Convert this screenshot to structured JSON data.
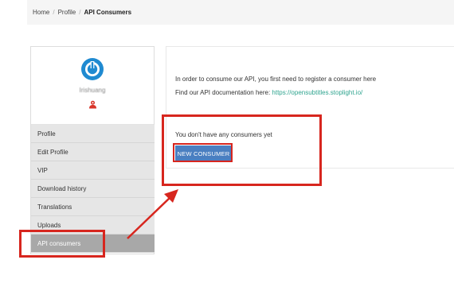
{
  "breadcrumb": {
    "items": [
      {
        "label": "Home"
      },
      {
        "label": "Profile"
      },
      {
        "label": "API Consumers"
      }
    ],
    "separator": "/"
  },
  "sidebar": {
    "username": "Irishuang",
    "logo_icon": "power-logo-icon",
    "badge_icon": "user-rank-icon",
    "menu": [
      {
        "label": "Profile",
        "active": false
      },
      {
        "label": "Edit Profile",
        "active": false
      },
      {
        "label": "VIP",
        "active": false
      },
      {
        "label": "Download history",
        "active": false
      },
      {
        "label": "Translations",
        "active": false
      },
      {
        "label": "Uploads",
        "active": false
      },
      {
        "label": "API consumers",
        "active": true
      }
    ]
  },
  "main": {
    "intro_text": "In order to consume our API, you first need to register a consumer here",
    "doc_prefix": "Find our API documentation here: ",
    "doc_link": "https://opensubtitles.stoplight.io/",
    "empty_text": "You don't have any consumers yet",
    "new_consumer_label": "NEW CONSUMER"
  },
  "colors": {
    "brand_blue": "#1f8ad1",
    "button_blue": "#4a7fc1",
    "link_teal": "#2fa48f",
    "annotation_red": "#d7261e",
    "active_menu": "#a8a8a8",
    "menu_bg": "#e6e6e6"
  }
}
